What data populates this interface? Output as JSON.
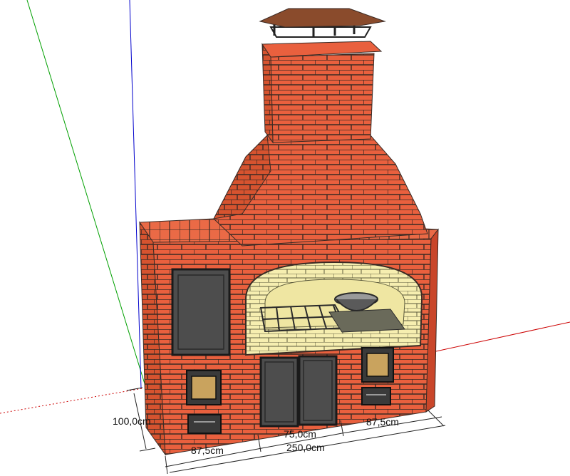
{
  "dimensions": {
    "height": "100,0cm",
    "left_width": "87,5cm",
    "center_width": "75,0cm",
    "right_width": "87,5cm",
    "total_width": "250,0cm"
  },
  "colors": {
    "brick": "#e9603e",
    "brick_dark": "#c9462a",
    "mortar": "#3a2a24",
    "firebrick": "#f6eeb0",
    "roof": "#8a4b2c",
    "door": "#4d4d4d",
    "axis_red": "#cc0000",
    "axis_green": "#00a000",
    "axis_blue": "#0000cc"
  }
}
